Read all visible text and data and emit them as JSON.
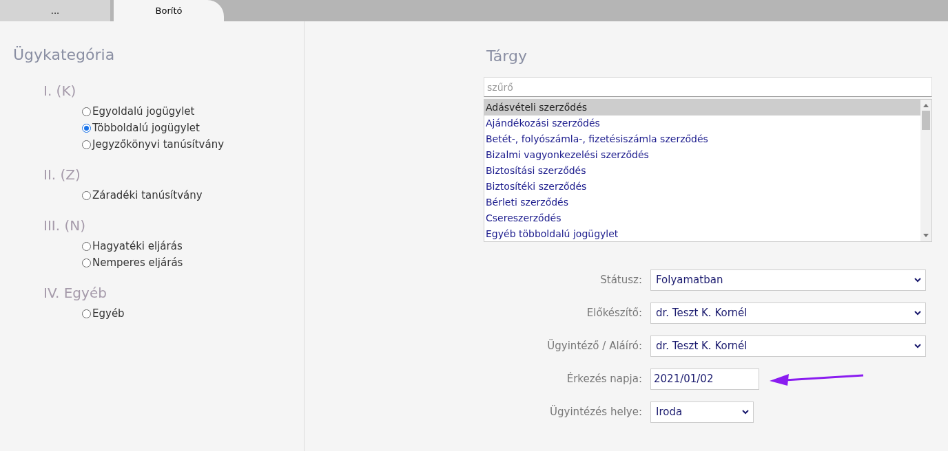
{
  "tabs": [
    {
      "label": "...",
      "selected": false
    },
    {
      "label": "Borító",
      "selected": true
    }
  ],
  "category": {
    "title": "Ügykategória",
    "groups": [
      {
        "heading": "I. (K)",
        "options": [
          {
            "label": "Egyoldalú jogügylet",
            "selected": false
          },
          {
            "label": "Többoldalú jogügylet",
            "selected": true
          },
          {
            "label": "Jegyzőkönyvi tanúsítvány",
            "selected": false
          }
        ]
      },
      {
        "heading": "II. (Z)",
        "options": [
          {
            "label": "Záradéki tanúsítvány",
            "selected": false
          }
        ]
      },
      {
        "heading": "III. (N)",
        "options": [
          {
            "label": "Hagyatéki eljárás",
            "selected": false
          },
          {
            "label": "Nemperes eljárás",
            "selected": false
          }
        ]
      },
      {
        "heading": "IV. Egyéb",
        "options": [
          {
            "label": "Egyéb",
            "selected": false
          }
        ]
      }
    ]
  },
  "subject": {
    "title": "Tárgy",
    "filter": {
      "placeholder": "szűrő"
    },
    "items": [
      {
        "label": "Adásvételi szerződés",
        "selected": true
      },
      {
        "label": "Ajándékozási szerződés",
        "selected": false
      },
      {
        "label": "Betét-, folyószámla-, fizetésiszámla szerződés",
        "selected": false
      },
      {
        "label": "Bizalmi vagyonkezelési szerződés",
        "selected": false
      },
      {
        "label": "Biztosítási szerződés",
        "selected": false
      },
      {
        "label": "Biztosítéki szerződés",
        "selected": false
      },
      {
        "label": "Bérleti szerződés",
        "selected": false
      },
      {
        "label": "Csereszerződés",
        "selected": false
      },
      {
        "label": "Egyéb többoldalú jogügylet",
        "selected": false
      }
    ]
  },
  "fields": [
    {
      "kind": "select",
      "label": "Státusz:",
      "value": "Folyamatban"
    },
    {
      "kind": "select",
      "label": "Előkészítő:",
      "value": "dr. Teszt K. Kornél"
    },
    {
      "kind": "select",
      "label": "Ügyintéző / Aláíró:",
      "value": "dr. Teszt K. Kornél"
    },
    {
      "kind": "date",
      "label": "Érkezés napja:",
      "value": "2021/01/02",
      "annotated": true
    },
    {
      "kind": "short_select",
      "label": "Ügyintézés helye:",
      "value": "Iroda"
    }
  ]
}
